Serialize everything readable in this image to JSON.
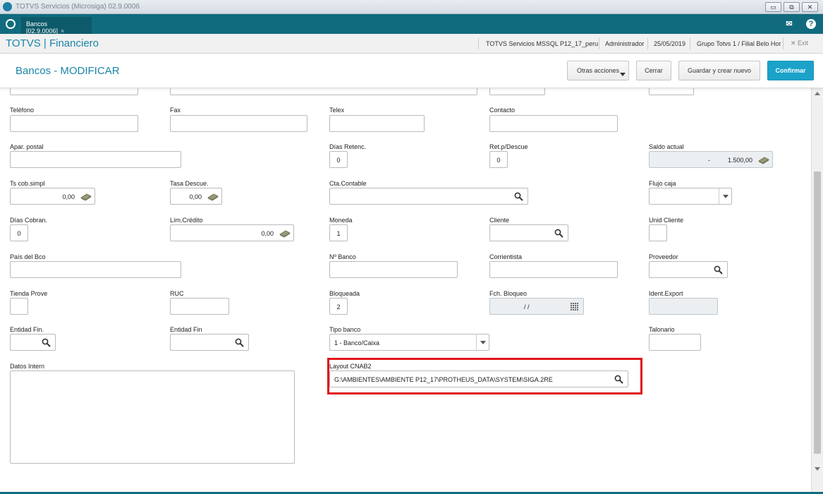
{
  "window": {
    "title": "TOTVS Servicios (Microsiga) 02.9.0006",
    "controls": [
      "▭",
      "⧉",
      "✕"
    ]
  },
  "tabbar": {
    "tab_label": "Bancos [02.9.0006]",
    "tab_close": "×",
    "mail_icon": "✉",
    "help_icon": "?"
  },
  "header": {
    "brand": "TOTVS | Financiero",
    "server": "TOTVS Servicios MSSQL P12_17_peru",
    "user": "Administrador",
    "date": "25/05/2019",
    "branch": "Grupo Totvs 1 / Filial Belo Hor",
    "exit_label": "✕  Exit"
  },
  "actionbar": {
    "title": "Bancos - MODIFICAR",
    "other_actions": "Otras acciones",
    "close": "Cerrar",
    "save_new": "Guardar y crear nuevo",
    "confirm": "Confirmar"
  },
  "form": {
    "telefono": {
      "label": "Teléfono",
      "value": ""
    },
    "fax": {
      "label": "Fax",
      "value": ""
    },
    "telex": {
      "label": "Telex",
      "value": ""
    },
    "contacto": {
      "label": "Contacto",
      "value": ""
    },
    "apar_postal": {
      "label": "Apar. postal",
      "value": ""
    },
    "dias_retenc": {
      "label": "Días Retenc.",
      "value": "0"
    },
    "ret_descue": {
      "label": "Ret.p/Descue",
      "value": "0"
    },
    "saldo_actual": {
      "label": "Saldo actual",
      "value": "-          1.500,00"
    },
    "ts_cob_simpl": {
      "label": "Ts cob.simpl",
      "value": "0,00"
    },
    "tasa_descue": {
      "label": "Tasa Descue.",
      "value": "0,00"
    },
    "cta_contable": {
      "label": "Cta.Contable",
      "value": ""
    },
    "flujo_caja": {
      "label": "Flujo caja",
      "value": ""
    },
    "dias_cobran": {
      "label": "Días Cobran.",
      "value": "0"
    },
    "lim_credito": {
      "label": "Lím.Crédito",
      "value": "0,00"
    },
    "moneda": {
      "label": "Moneda",
      "value": "1"
    },
    "cliente": {
      "label": "Cliente",
      "value": ""
    },
    "unid_cliente": {
      "label": "Unid Cliente",
      "value": ""
    },
    "pais_bco": {
      "label": "País del Bco",
      "value": ""
    },
    "n_banco": {
      "label": "Nº Banco",
      "value": ""
    },
    "correntista": {
      "label": "Corrientista",
      "value": ""
    },
    "proveedor": {
      "label": "Proveedor",
      "value": ""
    },
    "tienda_prove": {
      "label": "Tienda Prove",
      "value": ""
    },
    "ruc": {
      "label": "RUC",
      "value": ""
    },
    "bloqueada": {
      "label": "Bloqueada",
      "value": "2"
    },
    "fch_bloqueo": {
      "label": "Fch. Bloqueo",
      "value": "/ /"
    },
    "ident_export": {
      "label": "Ident.Export",
      "value": ""
    },
    "entidad_fin_1": {
      "label": "Entidad Fin.",
      "value": ""
    },
    "entidad_fin_2": {
      "label": "Entidad Fin",
      "value": ""
    },
    "tipo_banco": {
      "label": "Tipo banco",
      "value": "1 - Banco/Caixa"
    },
    "talonario": {
      "label": "Talonario",
      "value": ""
    },
    "datos_intern": {
      "label": "Datos Intern",
      "value": ""
    },
    "layout_cnab2": {
      "label": "Layout CNAB2",
      "value": "G:\\AMBIENTES\\AMBIENTE P12_17\\PROTHEUS_DATA\\SYSTEM\\SIGA.2RE"
    }
  },
  "colors": {
    "brand": "#116b7e",
    "accent": "#1a85a8",
    "primary_button": "#1aa2c9",
    "highlight": "#e0141b"
  }
}
